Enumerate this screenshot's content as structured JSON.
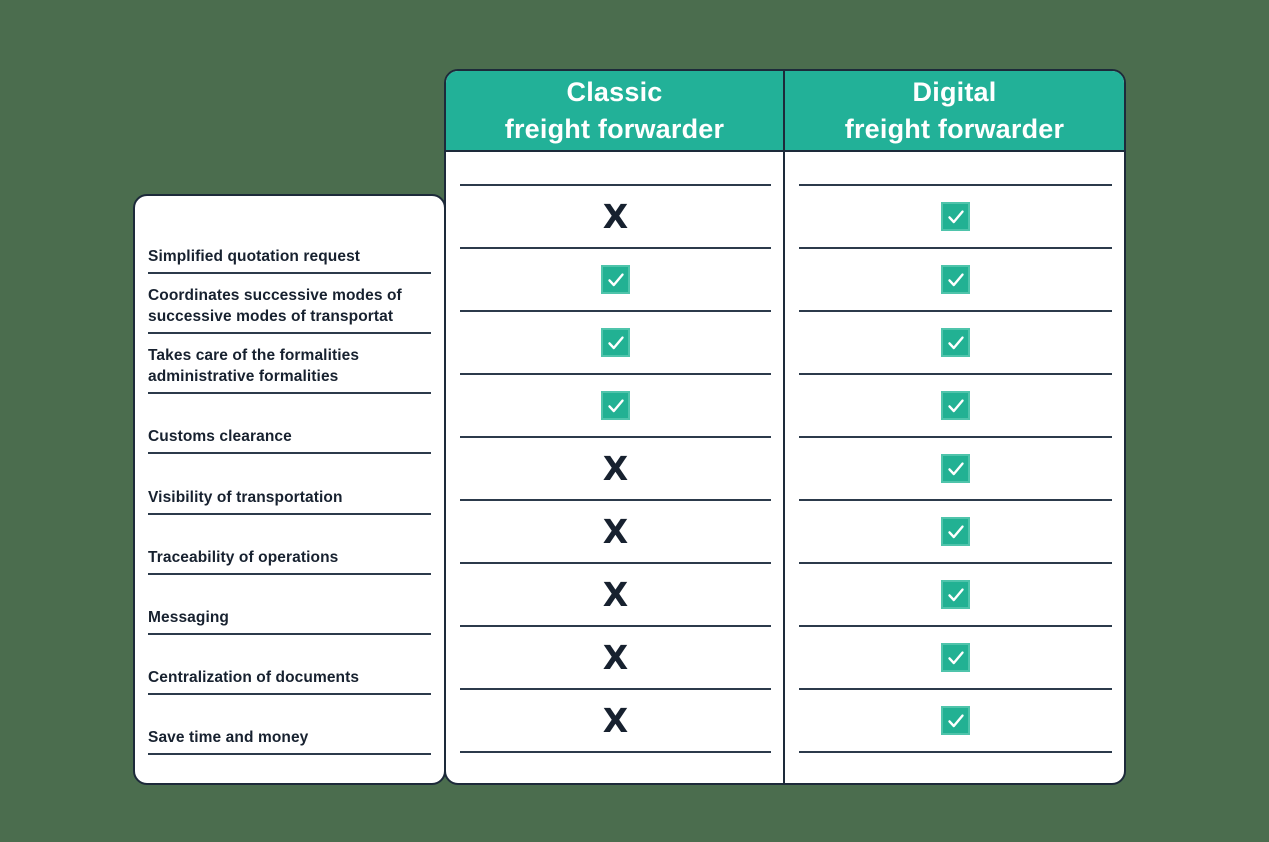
{
  "background_color": "#4b6d4e",
  "accent_color": "#22b198",
  "ink_color": "#17212f",
  "columns": [
    {
      "title_line1": "Classic",
      "title_line2": "freight forwarder"
    },
    {
      "title_line1": "Digital",
      "title_line2": "freight forwarder"
    }
  ],
  "rows": [
    {
      "label": "Simplified quotation request",
      "classic": "x",
      "digital": "check"
    },
    {
      "label": "Coordinates successive modes of successive modes of transportat",
      "label_line1": "Coordinates successive modes of",
      "label_line2": "successive modes of transportat",
      "classic": "check",
      "digital": "check"
    },
    {
      "label": "Takes care of the formalities administrative formalities",
      "label_line1": "Takes care of the formalities",
      "label_line2": "administrative formalities",
      "classic": "check",
      "digital": "check"
    },
    {
      "label": "Customs clearance",
      "classic": "check",
      "digital": "check"
    },
    {
      "label": "Visibility of transportation",
      "classic": "x",
      "digital": "check"
    },
    {
      "label": "Traceability of operations",
      "classic": "x",
      "digital": "check"
    },
    {
      "label": "Messaging",
      "classic": "x",
      "digital": "check"
    },
    {
      "label": "Centralization of documents",
      "classic": "x",
      "digital": "check"
    },
    {
      "label": "Save time and money",
      "classic": "x",
      "digital": "check"
    }
  ],
  "symbols": {
    "x": "X",
    "check": "✓"
  }
}
